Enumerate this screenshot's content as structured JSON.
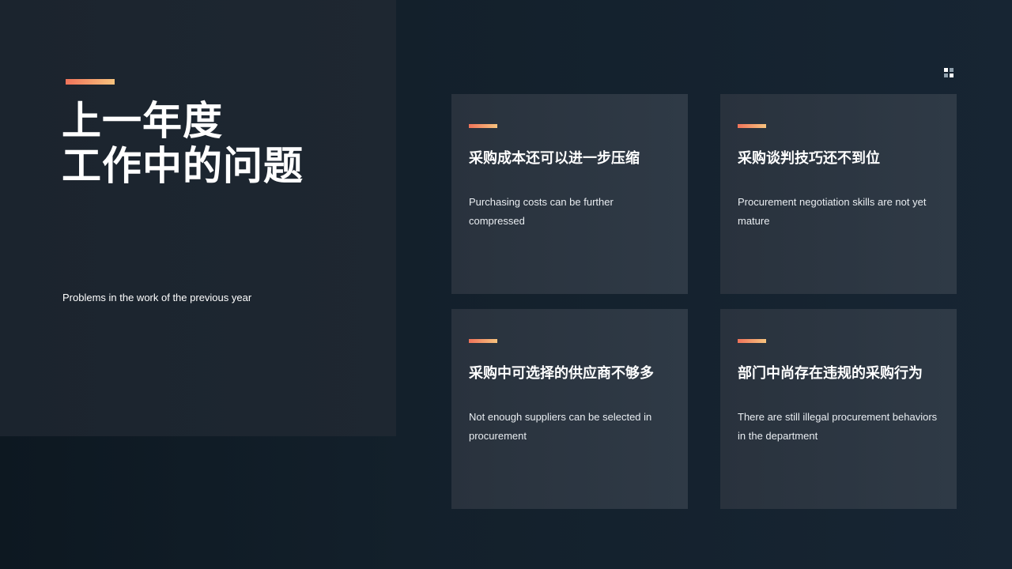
{
  "page": {
    "title_line1": "上一年度",
    "title_line2": "工作中的问题",
    "subtitle": "Problems in the work of the previous year"
  },
  "colors": {
    "background": "#13202b",
    "panel": "#1e2731",
    "card": "#2c3641",
    "accent_start": "#f0735a",
    "accent_end": "#f7c37e",
    "text": "#ffffff"
  },
  "cards": [
    {
      "title": "采购成本还可以进一步压缩",
      "description": "Purchasing costs can be further compressed"
    },
    {
      "title": "采购谈判技巧还不到位",
      "description": "Procurement negotiation skills are not yet mature"
    },
    {
      "title": "采购中可选择的供应商不够多",
      "description": "Not enough suppliers can be selected in procurement"
    },
    {
      "title": "部门中尚存在违规的采购行为",
      "description": "There are still illegal procurement behaviors in the department"
    }
  ],
  "decor": {
    "corner_icon": "grid-squares-icon"
  }
}
